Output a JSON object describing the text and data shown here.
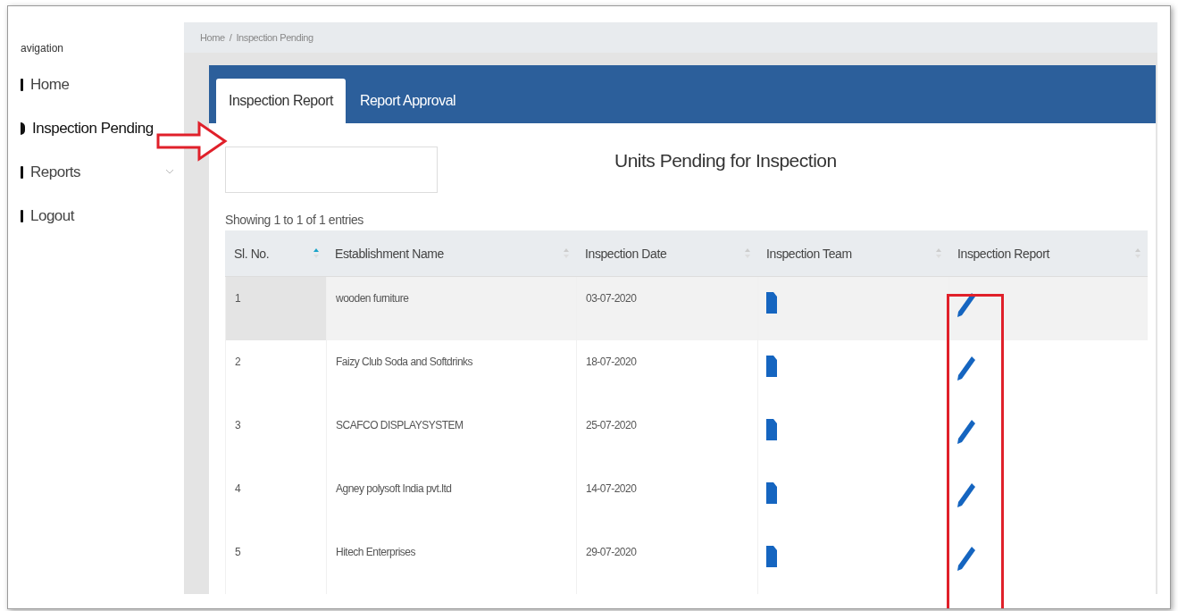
{
  "sidebar": {
    "title": "avigation",
    "items": [
      {
        "label": "Home",
        "selected": false,
        "expandable": false
      },
      {
        "label": "Inspection Pending",
        "selected": true,
        "expandable": false
      },
      {
        "label": "Reports",
        "selected": false,
        "expandable": true
      },
      {
        "label": "Logout",
        "selected": false,
        "expandable": false
      }
    ]
  },
  "breadcrumb": [
    "Home",
    "/",
    "Inspection Pending"
  ],
  "tabs": [
    {
      "label": "Inspection Report",
      "selected": true
    },
    {
      "label": "Report Approval",
      "selected": false
    }
  ],
  "heading": "Units Pending for Inspection",
  "info": "Showing 1 to 1 of 1 entries",
  "table": {
    "columns": [
      {
        "label": "Sl. No.",
        "sorted": true
      },
      {
        "label": "Establishment Name",
        "sorted": false
      },
      {
        "label": "Inspection Date",
        "sorted": false
      },
      {
        "label": "Inspection Team",
        "sorted": false
      },
      {
        "label": "Inspection Report",
        "sorted": false
      }
    ],
    "rows": [
      {
        "no": "1",
        "name": "wooden furniture",
        "date": "03-07-2020",
        "selected": true
      },
      {
        "no": "2",
        "name": "Faizy Club Soda and Softdrinks",
        "date": "18-07-2020",
        "selected": false
      },
      {
        "no": "3",
        "name": "SCAFCO DISPLAYSYSTEM",
        "date": "25-07-2020",
        "selected": false
      },
      {
        "no": "4",
        "name": "Agney polysoft India pvt.ltd",
        "date": "14-07-2020",
        "selected": false
      },
      {
        "no": "5",
        "name": "Hitech Enterprises",
        "date": "29-07-2020",
        "selected": false
      }
    ]
  }
}
